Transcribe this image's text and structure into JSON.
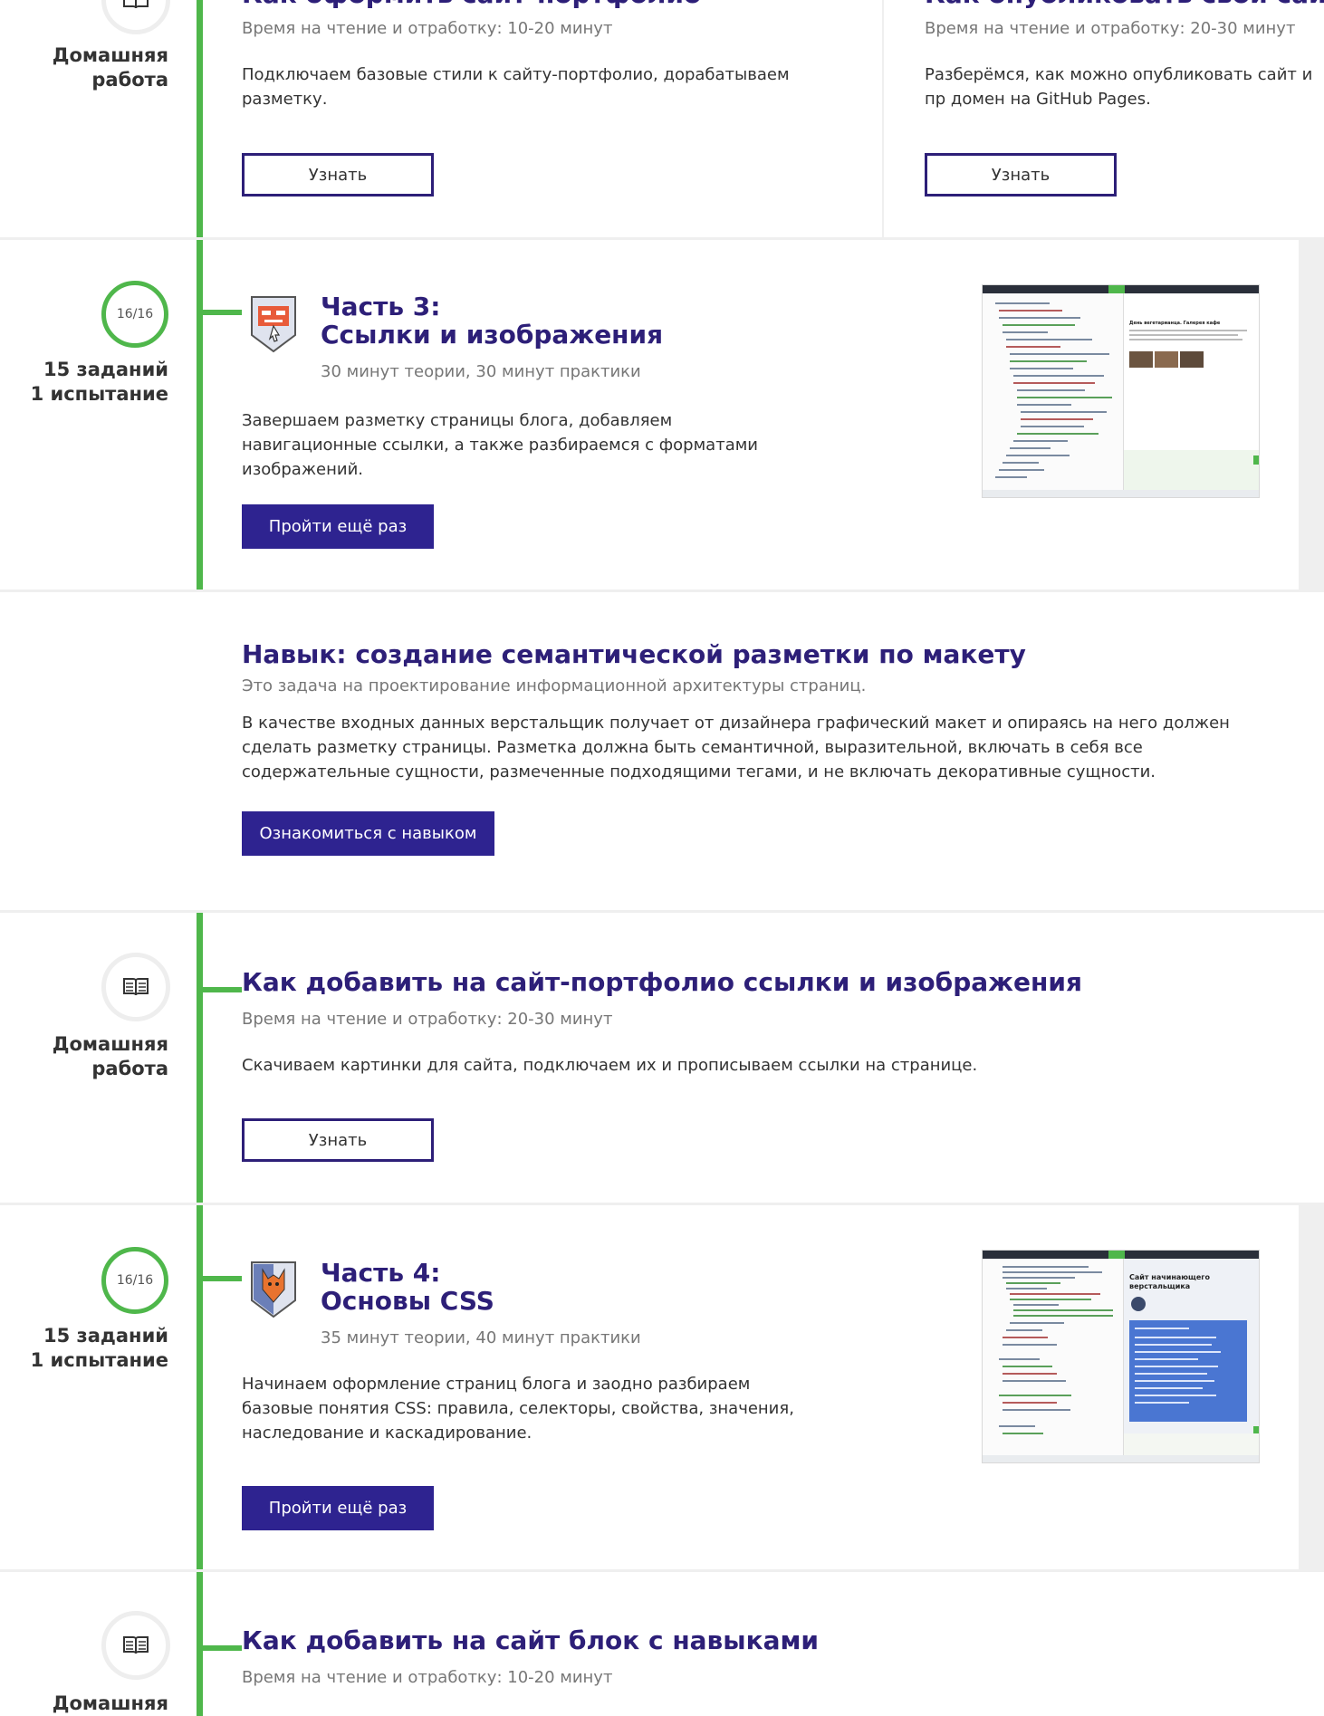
{
  "top_section": {
    "left_label": [
      "Домашняя",
      "работа"
    ],
    "col1": {
      "title": "Как оформить сайт-портфолио",
      "meta": "Время на чтение и отработку: 10-20 минут",
      "desc": "Подключаем базовые стили к сайту-портфолио, дорабатываем разметку.",
      "button": "Узнать"
    },
    "col2": {
      "title": "Как опубликовать свой сайт на",
      "meta": "Время на чтение и отработку: 20-30 минут",
      "desc": "Разберёмся, как можно опубликовать сайт и пр домен на GitHub Pages.",
      "button": "Узнать"
    }
  },
  "part3": {
    "progress": "16/16",
    "tasks": "15 заданий",
    "trials": "1 испытание",
    "title_line1": "Часть 3:",
    "title_line2": "Ссылки и изображения",
    "meta": "30 минут теории, 30 минут практики",
    "desc": "Завершаем разметку страницы блога, добавляем навигационные ссылки, а также разбираемся с форматами изображений.",
    "button": "Пройти ещё раз",
    "preview_title": "День вегетарианца. Галерея кафе"
  },
  "skill": {
    "title": "Навык: создание семантической разметки по макету",
    "subtitle": "Это задача на проектирование информационной архитектуры страниц.",
    "desc": "В качестве входных данных верстальщик получает от дизайнера графический макет и опираясь на него должен сделать разметку страницы. Разметка должна быть семантичной, выразительной, включать в себя все содержательные сущности, размеченные подходящими тегами, и не включать декоративные сущности.",
    "button": "Ознакомиться с навыком"
  },
  "hw2": {
    "left_label": [
      "Домашняя",
      "работа"
    ],
    "title": "Как добавить на сайт-портфолио ссылки и изображения",
    "meta": "Время на чтение и отработку: 20-30 минут",
    "desc": "Скачиваем картинки для сайта, подключаем их и прописываем ссылки на странице.",
    "button": "Узнать"
  },
  "part4": {
    "progress": "16/16",
    "tasks": "15 заданий",
    "trials": "1 испытание",
    "title_line1": "Часть 4:",
    "title_line2": "Основы CSS",
    "meta": "35 минут теории, 40 минут практики",
    "desc": "Начинаем оформление страниц блога и заодно разбираем базовые понятия CSS: правила, селекторы, свойства, значения, наследование и каскадирование.",
    "button": "Пройти ещё раз",
    "preview_title": "Сайт начинающего верстальщика"
  },
  "hw3": {
    "left_label": [
      "Домашняя"
    ],
    "title": "Как добавить на сайт блок с навыками",
    "meta": "Время на чтение и отработку: 10-20 минут"
  },
  "colors": {
    "accent": "#2d1f78",
    "button_fill": "#2e2390",
    "timeline": "#4fb74b"
  }
}
